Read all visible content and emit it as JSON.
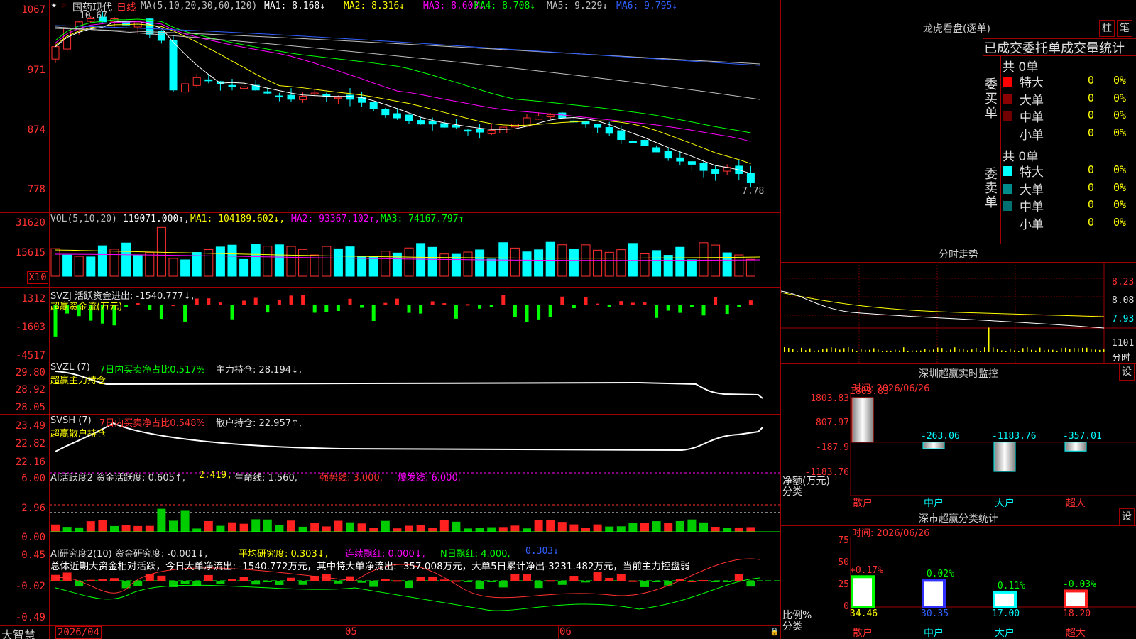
{
  "stock": {
    "name": "国药现代",
    "period": "日线",
    "price_high_label": "10.67",
    "price_low_label": "7.78",
    "ma_header": "MA(5,10,20,30,60,120)",
    "ma1": "MA1: 8.168↓",
    "ma2": "MA2: 8.316↓",
    "ma3": "MA3: 8.603↓",
    "ma4": "MA4: 8.708↓",
    "ma5": "MA5: 9.229↓",
    "ma6": "MA6: 9.795↓"
  },
  "axes": {
    "price": [
      "1067",
      "971",
      "874",
      "778"
    ],
    "vol": [
      "31620",
      "15615",
      "X10"
    ],
    "svzj": [
      "1312",
      "-1603",
      "-4517"
    ],
    "svzl": [
      "29.80",
      "28.92",
      "28.05"
    ],
    "svsh": [
      "23.49",
      "22.82",
      "22.16"
    ],
    "ai1": [
      "6.00",
      "2.96",
      "0.00"
    ],
    "ai2": [
      "0.45",
      "-0.02",
      "-0.49"
    ],
    "dates": [
      "2026/04",
      "05",
      "06"
    ]
  },
  "vol": {
    "header": "VOL(5,10,20)",
    "value": "119071.000↑,",
    "ma1": "MA1: 104189.602↓,",
    "ma2": "MA2: 93367.102↑,",
    "ma3": "MA3: 74167.797↑"
  },
  "svzj": {
    "header": "SVZJ  活跃资金进出: -1540.777↓,",
    "sub": "超赢资金流(万元)"
  },
  "svzl": {
    "header": "SVZL (7)",
    "ratio": "7日内买卖净占比0.517%",
    "hold": "主力持仓: 28.194↓,",
    "sub": "超赢主力持仓"
  },
  "svsh": {
    "header": "SVSH (7)",
    "ratio": "7日内买卖净占比0.548%",
    "hold": "散户持仓: 22.957↑,",
    "sub": "超赢散户持仓"
  },
  "ai1": {
    "header": "AI活跃度2 资金活跃度: 0.605↑,",
    "v2": "2.419,",
    "life": "生命线: 1.560,",
    "strong": "强势线: 3.000,",
    "burst": "爆发线: 6.000,"
  },
  "ai2": {
    "header": "AI研究度2(10) 资金研究度: -0.001↓,",
    "avg": "平均研究度: 0.303↓,",
    "cont": "连续飘红: 0.000↓,",
    "nday": "N日飘红: 4.000,",
    "last": "0.303↓",
    "summary": "总体近期大资金相对活跃，今日大单净流出: -1540.772万元，其中特大单净流出: -357.008万元，大单5日累计净出-3231.482万元，当前主力控盘弱"
  },
  "footer": {
    "brand": "大智慧"
  },
  "longhu": {
    "title": "龙虎看盘(逐单)",
    "btn1": "柱",
    "btn2": "笔",
    "heading": "已成交委托单成交量统计",
    "buy_label": "委买单",
    "sell_label": "委卖单",
    "buy_total": "共 0单",
    "sell_total": "共 0单",
    "rows": [
      {
        "name": "特大",
        "count": "0",
        "pct": "0%"
      },
      {
        "name": "大单",
        "count": "0",
        "pct": "0%"
      },
      {
        "name": "中单",
        "count": "0",
        "pct": "0%"
      },
      {
        "name": "小单",
        "count": "0",
        "pct": "0%"
      }
    ],
    "colors": {
      "buy": [
        "#ff0000",
        "#8b0000",
        "#700000",
        "#000000"
      ],
      "sell": [
        "#00ffff",
        "#008b8b",
        "#007070",
        "#000000"
      ]
    }
  },
  "fenshi": {
    "title": "分时走势",
    "prices": [
      "8.23",
      "8.08",
      "7.93"
    ],
    "vol_label": "1101",
    "bottom_label": "分时"
  },
  "sz_monitor": {
    "title": "深圳超赢实时监控",
    "btn": "设",
    "time": "时间: 2026/06/26",
    "yaxis": [
      "1803.83",
      "807.97",
      "-187.9",
      "-1183.76"
    ],
    "ylabel1": "净额(万元)",
    "ylabel2": "分类",
    "cats": [
      "散户",
      "中户",
      "大户",
      "超大"
    ],
    "values": [
      "1803.83",
      "-263.06",
      "-1183.76",
      "-357.01"
    ]
  },
  "sz_class": {
    "title": "深市超赢分类统计",
    "btn": "设",
    "time": "时间: 2026/06/26",
    "yaxis": [
      "75",
      "50",
      "25",
      "0"
    ],
    "ylabel1": "比例%",
    "ylabel2": "分类",
    "cats": [
      "散户",
      "中户",
      "大户",
      "超大"
    ],
    "pcts": [
      "34.46",
      "30.35",
      "17.00",
      "18.20"
    ],
    "changes": [
      "+0.17%",
      "-0.02%",
      "-0.11%",
      "-0.03%"
    ]
  },
  "chart_data": [
    {
      "type": "bar",
      "title": "深圳超赢实时监控",
      "ylabel": "净额(万元)",
      "categories": [
        "散户",
        "中户",
        "大户",
        "超大"
      ],
      "values": [
        1803.83,
        -263.06,
        -1183.76,
        -357.01
      ],
      "ylim": [
        -1183.76,
        1803.83
      ]
    },
    {
      "type": "bar",
      "title": "深市超赢分类统计",
      "ylabel": "比例%",
      "categories": [
        "散户",
        "中户",
        "大户",
        "超大"
      ],
      "values": [
        34.46,
        30.35,
        17.0,
        18.2
      ],
      "ylim": [
        0,
        75
      ]
    }
  ]
}
